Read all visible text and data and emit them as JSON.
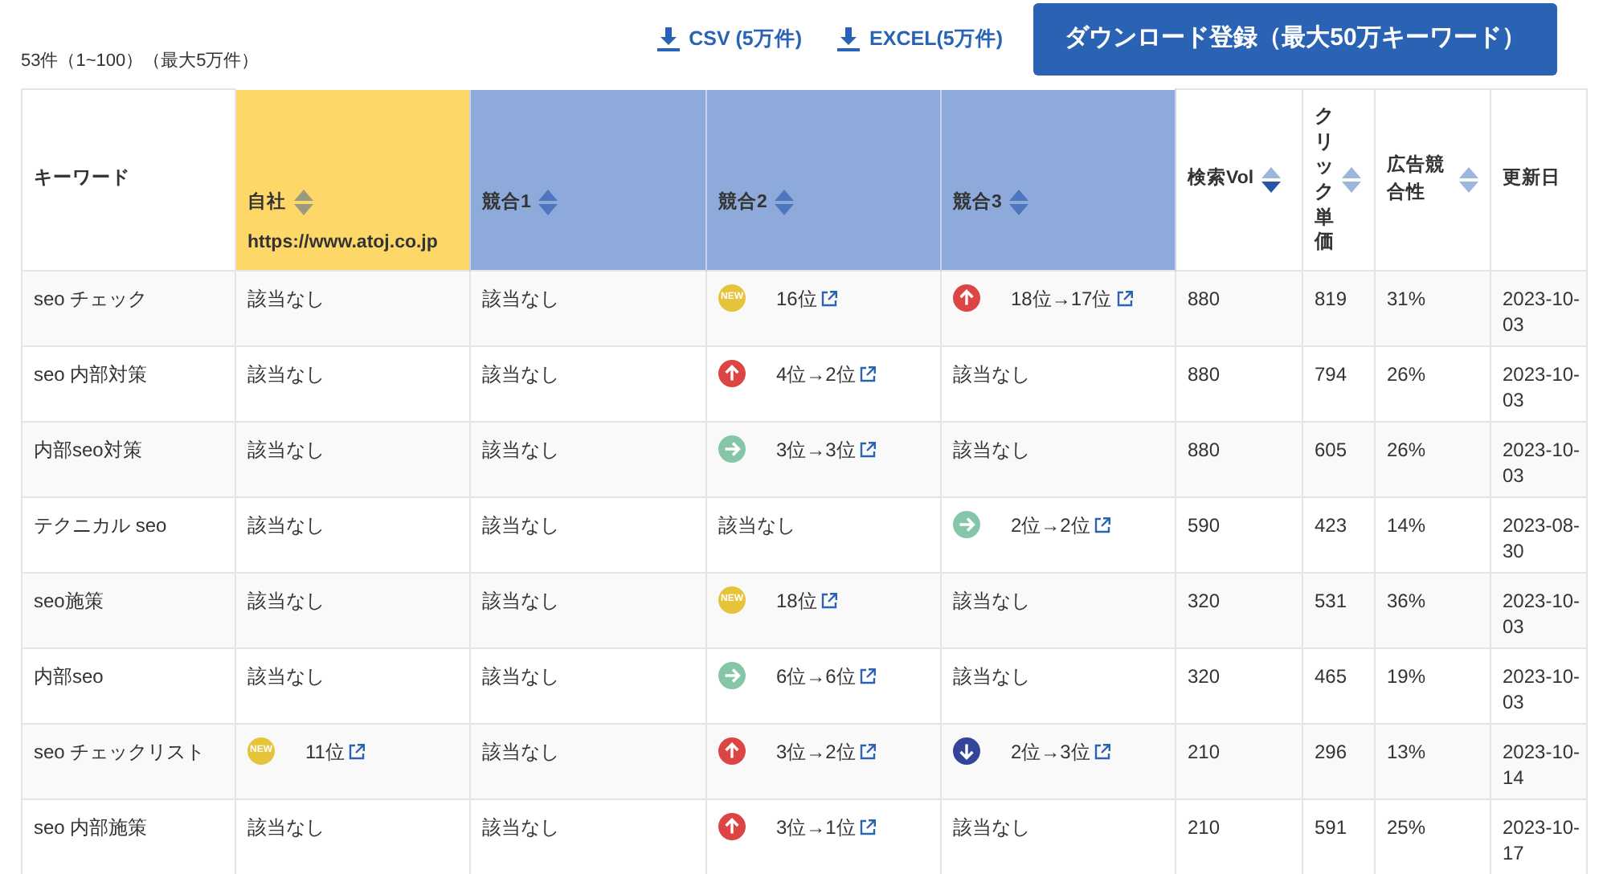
{
  "summary": "53件（1~100）（最大5万件）",
  "downloads": [
    {
      "label": "CSV (5万件)"
    },
    {
      "label": "EXCEL(5万件)"
    }
  ],
  "register_button": "ダウンロード登録（最大50万キーワード）",
  "table": {
    "columns": [
      {
        "label": "キーワード",
        "kind": "plain"
      },
      {
        "label": "自社",
        "kind": "own",
        "sortable": true,
        "sort_active": false,
        "url": "https://www.atoj.co.jp"
      },
      {
        "label": "競合1",
        "kind": "rival",
        "sortable": true,
        "sort_active": false
      },
      {
        "label": "競合2",
        "kind": "rival",
        "sortable": true,
        "sort_active": false
      },
      {
        "label": "競合3",
        "kind": "rival",
        "sortable": true,
        "sort_active": false
      },
      {
        "label": "検索Vol",
        "kind": "plain",
        "sortable": true,
        "sort_active": true
      },
      {
        "label": "クリック単価",
        "kind": "narrow",
        "sortable": true,
        "sort_active": false
      },
      {
        "label": "広告競合性",
        "kind": "plain",
        "sortable": true,
        "sort_active": false
      },
      {
        "label": "更新日",
        "kind": "plain"
      }
    ],
    "rows": [
      {
        "keyword": "seo チェック",
        "ranks": [
          {
            "kind": "none",
            "text": "該当なし"
          },
          {
            "kind": "none",
            "text": "該当なし"
          },
          {
            "kind": "new",
            "badge": "NEW",
            "text": "16位"
          },
          {
            "kind": "up",
            "text": "18位→17位"
          }
        ],
        "volume": "880",
        "cpc": "819",
        "competition": "31%",
        "updated": "2023-10-03"
      },
      {
        "keyword": "seo 内部対策",
        "ranks": [
          {
            "kind": "none",
            "text": "該当なし"
          },
          {
            "kind": "none",
            "text": "該当なし"
          },
          {
            "kind": "up",
            "text": "4位→2位"
          },
          {
            "kind": "none",
            "text": "該当なし"
          }
        ],
        "volume": "880",
        "cpc": "794",
        "competition": "26%",
        "updated": "2023-10-03"
      },
      {
        "keyword": "内部seo対策",
        "ranks": [
          {
            "kind": "none",
            "text": "該当なし"
          },
          {
            "kind": "none",
            "text": "該当なし"
          },
          {
            "kind": "flat",
            "text": "3位→3位"
          },
          {
            "kind": "none",
            "text": "該当なし"
          }
        ],
        "volume": "880",
        "cpc": "605",
        "competition": "26%",
        "updated": "2023-10-03"
      },
      {
        "keyword": "テクニカル seo",
        "ranks": [
          {
            "kind": "none",
            "text": "該当なし"
          },
          {
            "kind": "none",
            "text": "該当なし"
          },
          {
            "kind": "none",
            "text": "該当なし"
          },
          {
            "kind": "flat",
            "text": "2位→2位"
          }
        ],
        "volume": "590",
        "cpc": "423",
        "competition": "14%",
        "updated": "2023-08-30"
      },
      {
        "keyword": "seo施策",
        "ranks": [
          {
            "kind": "none",
            "text": "該当なし"
          },
          {
            "kind": "none",
            "text": "該当なし"
          },
          {
            "kind": "new",
            "badge": "NEW",
            "text": "18位"
          },
          {
            "kind": "none",
            "text": "該当なし"
          }
        ],
        "volume": "320",
        "cpc": "531",
        "competition": "36%",
        "updated": "2023-10-03"
      },
      {
        "keyword": "内部seo",
        "ranks": [
          {
            "kind": "none",
            "text": "該当なし"
          },
          {
            "kind": "none",
            "text": "該当なし"
          },
          {
            "kind": "flat",
            "text": "6位→6位"
          },
          {
            "kind": "none",
            "text": "該当なし"
          }
        ],
        "volume": "320",
        "cpc": "465",
        "competition": "19%",
        "updated": "2023-10-03"
      },
      {
        "keyword": "seo チェックリスト",
        "ranks": [
          {
            "kind": "new",
            "badge": "NEW",
            "text": "11位"
          },
          {
            "kind": "none",
            "text": "該当なし"
          },
          {
            "kind": "up",
            "text": "3位→2位"
          },
          {
            "kind": "down",
            "text": "2位→3位"
          }
        ],
        "volume": "210",
        "cpc": "296",
        "competition": "13%",
        "updated": "2023-10-14"
      },
      {
        "keyword": "seo 内部施策",
        "ranks": [
          {
            "kind": "none",
            "text": "該当なし"
          },
          {
            "kind": "none",
            "text": "該当なし"
          },
          {
            "kind": "up",
            "text": "3位→1位"
          },
          {
            "kind": "none",
            "text": "該当なし"
          }
        ],
        "volume": "210",
        "cpc": "591",
        "competition": "25%",
        "updated": "2023-10-17"
      }
    ]
  }
}
